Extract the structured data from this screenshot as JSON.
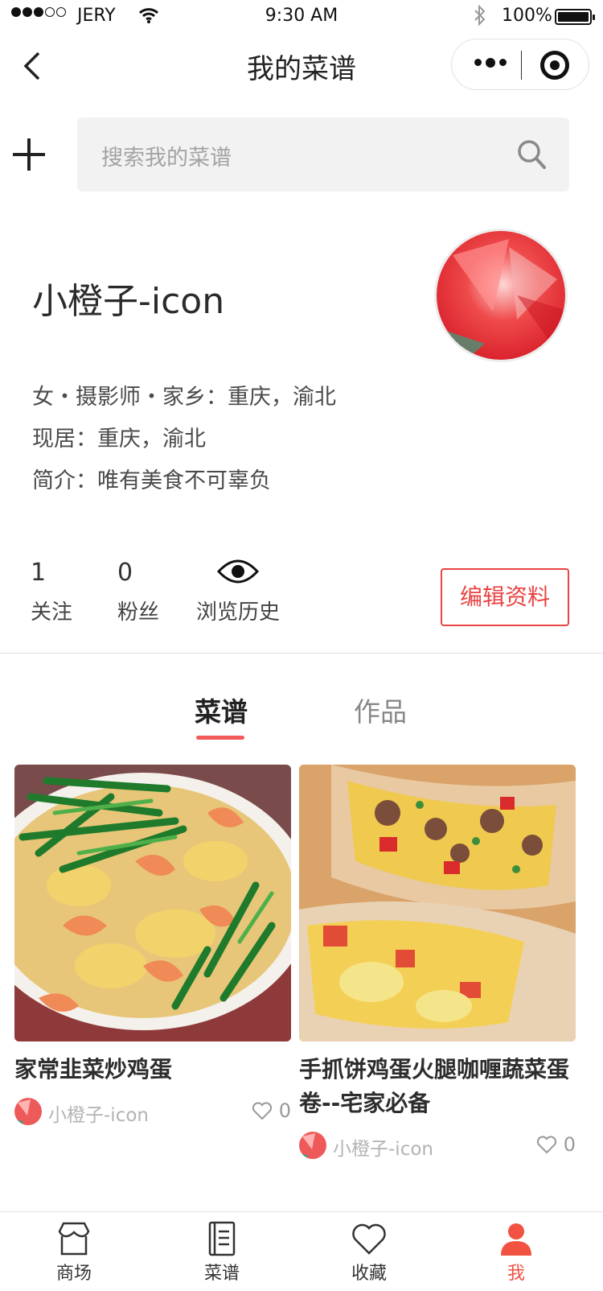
{
  "status_bar": {
    "carrier": "JERY",
    "time": "9:30 AM",
    "battery": "100%"
  },
  "nav": {
    "title": "我的菜谱"
  },
  "search": {
    "placeholder": "搜索我的菜谱"
  },
  "profile": {
    "name": "小橙子-icon",
    "line1": "女・摄影师・家乡：重庆，渝北",
    "line2": "现居：重庆，渝北",
    "line3": "简介：唯有美食不可辜负"
  },
  "stats": {
    "following_count": "1",
    "following_label": "关注",
    "fans_count": "0",
    "fans_label": "粉丝",
    "history_label": "浏览历史"
  },
  "edit_button": "编辑资料",
  "tabs": {
    "recipes": "菜谱",
    "works": "作品"
  },
  "recipes": [
    {
      "title": "家常韭菜炒鸡蛋",
      "author": "小橙子-icon",
      "likes": "0"
    },
    {
      "title": "手抓饼鸡蛋火腿咖喱蔬菜蛋卷--宅家必备",
      "author": "小橙子-icon",
      "likes": "0"
    }
  ],
  "tabbar": [
    {
      "label": "商场",
      "icon": "shop-icon"
    },
    {
      "label": "菜谱",
      "icon": "recipe-book-icon"
    },
    {
      "label": "收藏",
      "icon": "heart-icon"
    },
    {
      "label": "我",
      "icon": "person-icon"
    }
  ],
  "colors": {
    "accent": "#e94343",
    "tab_active": "#f25242"
  }
}
